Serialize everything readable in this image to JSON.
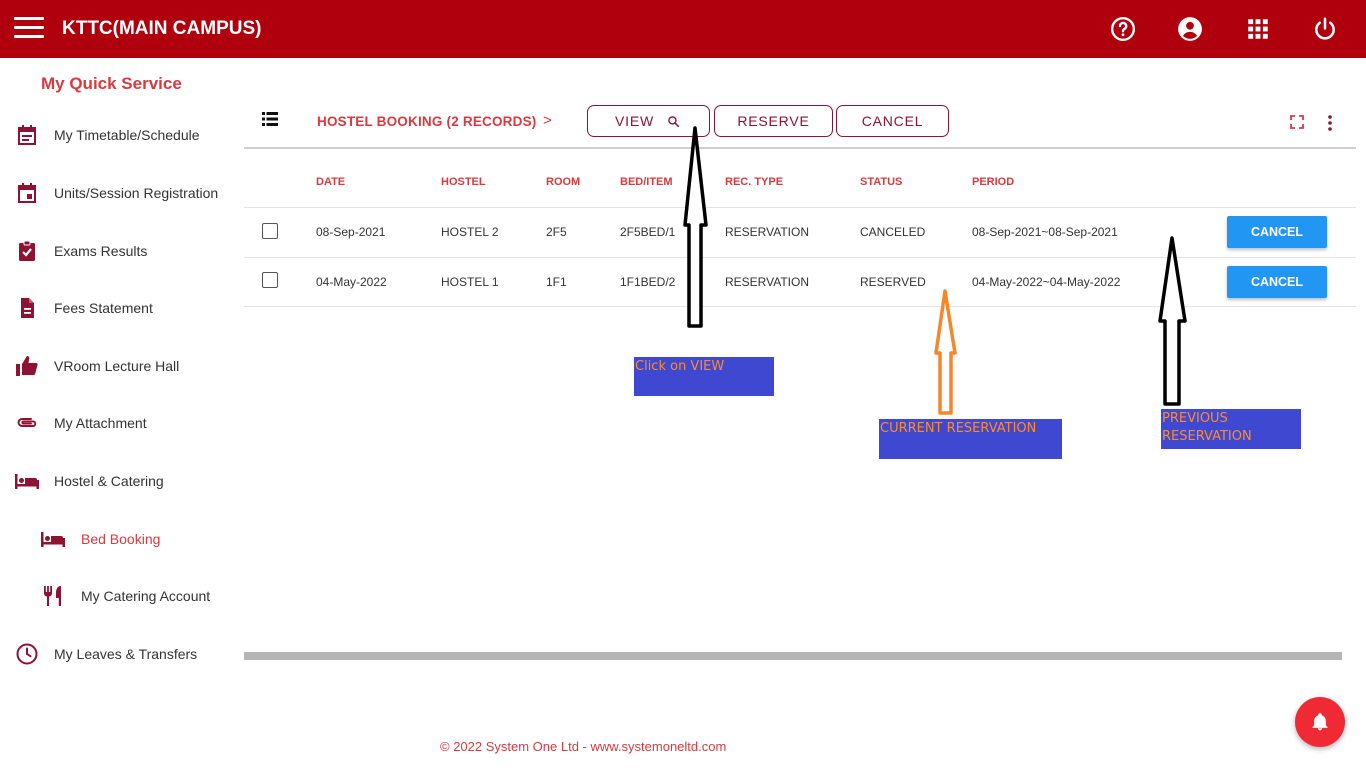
{
  "header": {
    "title": "KTTC(MAIN CAMPUS)",
    "icons": [
      "help-icon",
      "account-icon",
      "apps-icon",
      "power-icon"
    ]
  },
  "sidebar": {
    "title": "My Quick Service",
    "items": [
      {
        "label": "My Timetable/Schedule",
        "icon": "calendar-list-icon"
      },
      {
        "label": "Units/Session Registration",
        "icon": "calendar-event-icon"
      },
      {
        "label": "Exams Results",
        "icon": "clipboard-check-icon"
      },
      {
        "label": "Fees Statement",
        "icon": "document-icon"
      },
      {
        "label": "VRoom Lecture Hall",
        "icon": "thumb-up-icon"
      },
      {
        "label": "My Attachment",
        "icon": "paperclip-icon"
      },
      {
        "label": "Hostel & Catering",
        "icon": "bed-icon"
      },
      {
        "label": "Bed Booking",
        "icon": "bed-icon",
        "active": true
      },
      {
        "label": "My Catering Account",
        "icon": "restaurant-icon"
      },
      {
        "label": "My Leaves & Transfers",
        "icon": "clock-icon"
      }
    ]
  },
  "toolbar": {
    "breadcrumb": "HOSTEL BOOKING (2 RECORDS)",
    "chevron": ">",
    "view_label": "VIEW",
    "reserve_label": "RESERVE",
    "cancel_label": "CANCEL"
  },
  "table": {
    "columns": [
      "DATE",
      "HOSTEL",
      "ROOM",
      "BED/ITEM",
      "REC. TYPE",
      "STATUS",
      "PERIOD"
    ],
    "rows": [
      {
        "date": "08-Sep-2021",
        "hostel": "HOSTEL 2",
        "room": "2F5",
        "bed": "2F5BED/1",
        "rec_type": "RESERVATION",
        "status": "CANCELED",
        "period": "08-Sep-2021~08-Sep-2021",
        "action": "CANCEL"
      },
      {
        "date": "04-May-2022",
        "hostel": "HOSTEL 1",
        "room": "1F1",
        "bed": "1F1BED/2",
        "rec_type": "RESERVATION",
        "status": "RESERVED",
        "period": "04-May-2022~04-May-2022",
        "action": "CANCEL"
      }
    ]
  },
  "annotations": {
    "view_note": "Click on VIEW",
    "current_note": "CURRENT RESERVATION",
    "previous_note_line1": "PREVIOUS",
    "previous_note_line2": "RESERVATION"
  },
  "footer": {
    "text": "© 2022 System One Ltd - www.systemoneltd.com"
  },
  "colors": {
    "brand": "#b0000d",
    "accent_text": "#d9393f",
    "icon": "#8e1232",
    "button_blue": "#2196f3",
    "note_bg": "#3e48d0",
    "note_text": "#ff8a2b"
  }
}
